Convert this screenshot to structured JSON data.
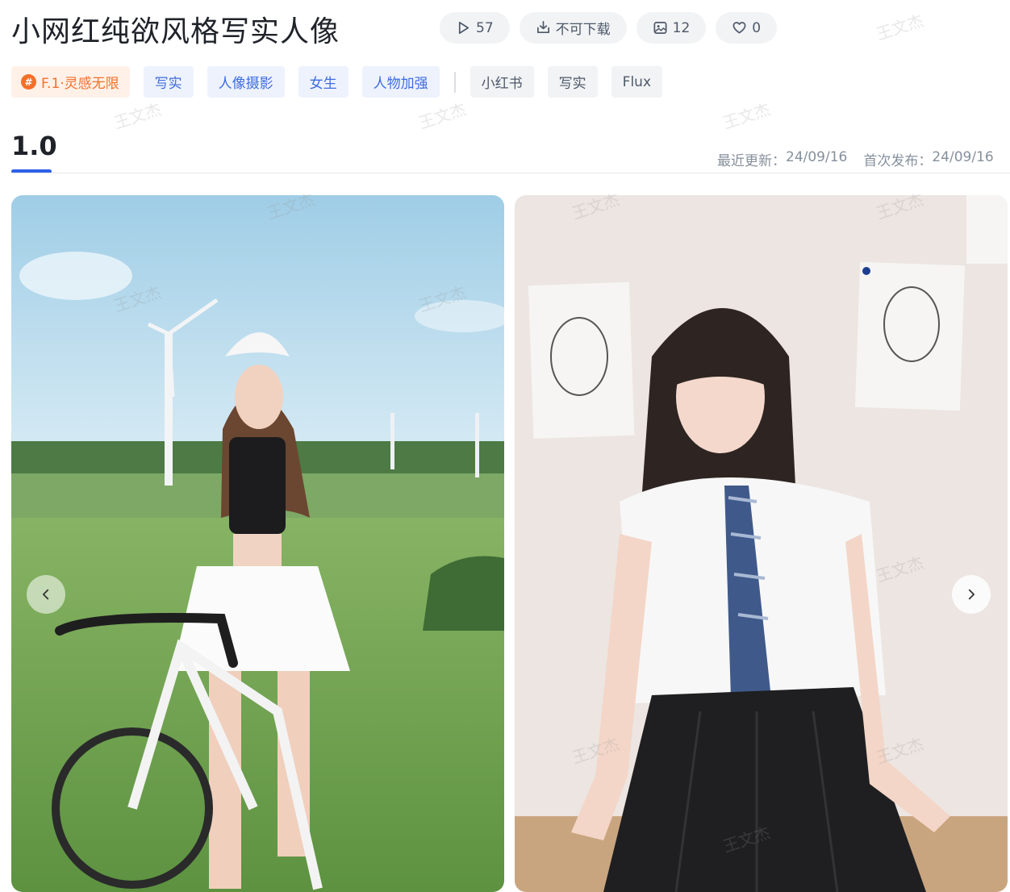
{
  "header": {
    "title": "小网红纯欲风格写实人像"
  },
  "stats": {
    "runs": "57",
    "download": "不可下载",
    "images": "12",
    "likes": "0"
  },
  "tags": {
    "feature": "F.1·灵感无限",
    "primary": [
      "写实",
      "人像摄影",
      "女生",
      "人物加强"
    ],
    "secondary": [
      "小红书",
      "写实",
      "Flux"
    ]
  },
  "version": {
    "label": "1.0",
    "updated_label": "最近更新：",
    "updated_value": "24/09/16",
    "published_label": "首次发布：",
    "published_value": "24/09/16"
  },
  "watermark": "王文杰",
  "gallery": {
    "images": [
      {
        "icon": "photo-girl-with-bicycle-in-field"
      },
      {
        "icon": "photo-girl-in-school-uniform-with-sketches"
      }
    ]
  },
  "colors": {
    "accent_blue": "#2e61e6",
    "tag_blue": "#3e6de0",
    "feature_orange": "#f4702a"
  }
}
